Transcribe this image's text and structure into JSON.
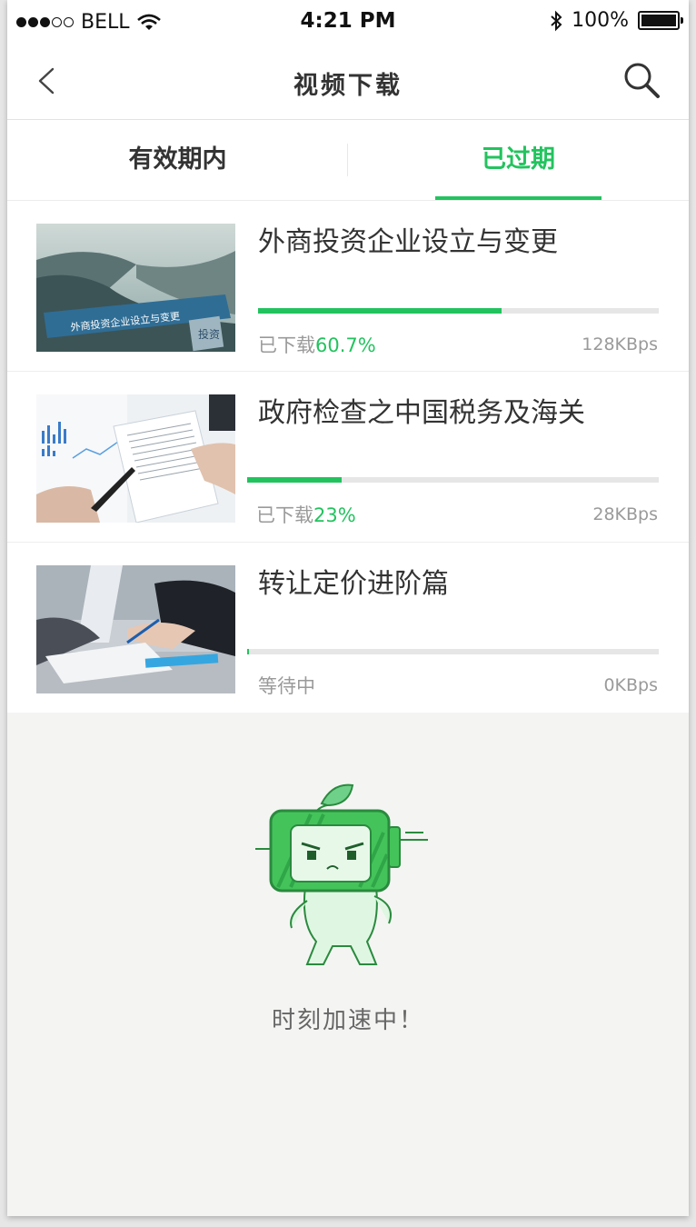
{
  "status_bar": {
    "carrier": "BELL",
    "time": "4:21 PM",
    "battery": "100%"
  },
  "nav": {
    "title": "视频下载"
  },
  "tabs": [
    {
      "label": "有效期内",
      "active": false
    },
    {
      "label": "已过期",
      "active": true
    }
  ],
  "downloads": [
    {
      "title": "外商投资企业设立与变更",
      "status_prefix": "已下载",
      "progress_text": "60.7%",
      "progress": 0.607,
      "speed": "128KBps",
      "thumb_text": "外商投资企业设立与变更",
      "thumb_badge": "投资"
    },
    {
      "title": "政府检查之中国税务及海关",
      "status_prefix": "已下载",
      "progress_text": "23%",
      "progress": 0.23,
      "speed": "28KBps"
    },
    {
      "title": "转让定价进阶篇",
      "status_prefix": "等待中",
      "progress_text": "",
      "progress": 0.0,
      "speed": "0KBps"
    }
  ],
  "empty_state": {
    "caption": "时刻加速中！"
  },
  "colors": {
    "accent": "#22c35e",
    "track": "#e6e6e6",
    "muted_text": "#9a9a9a"
  }
}
